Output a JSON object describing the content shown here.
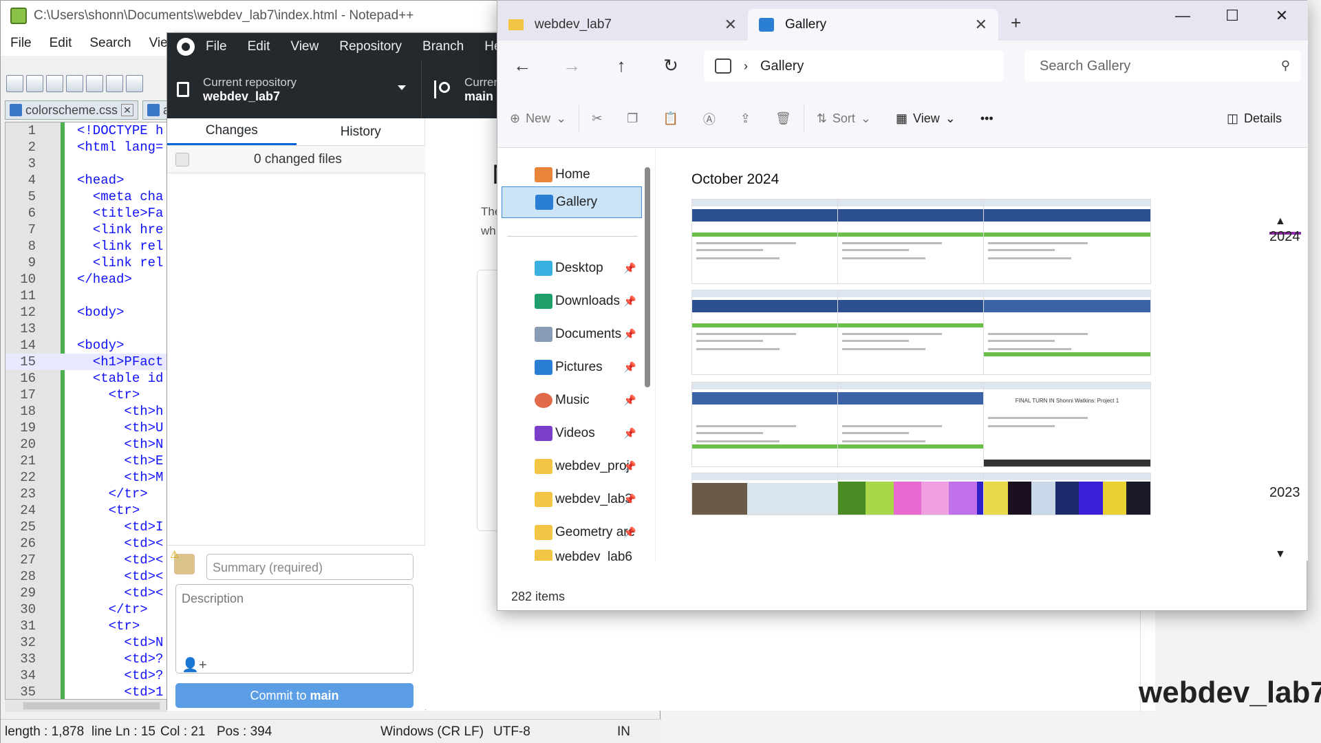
{
  "notepad": {
    "title": "C:\\Users\\shonn\\Documents\\webdev_lab7\\index.html - Notepad++",
    "menu": [
      "File",
      "Edit",
      "Search",
      "View"
    ],
    "tabs": [
      "colorscheme.css",
      "a"
    ],
    "lines": [
      {
        "n": "1",
        "code": "<!DOCTYPE h"
      },
      {
        "n": "2",
        "code": "<html lang="
      },
      {
        "n": "3",
        "code": ""
      },
      {
        "n": "4",
        "code": "<head>"
      },
      {
        "n": "5",
        "code": "  <meta cha"
      },
      {
        "n": "6",
        "code": "  <title>Fa"
      },
      {
        "n": "7",
        "code": "  <link hre"
      },
      {
        "n": "8",
        "code": "  <link rel"
      },
      {
        "n": "9",
        "code": "  <link rel"
      },
      {
        "n": "10",
        "code": "</head>"
      },
      {
        "n": "11",
        "code": ""
      },
      {
        "n": "12",
        "code": "<body>"
      },
      {
        "n": "13",
        "code": ""
      },
      {
        "n": "14",
        "code": "<body>"
      },
      {
        "n": "15",
        "code": "  <h1>PFact"
      },
      {
        "n": "16",
        "code": "  <table id"
      },
      {
        "n": "17",
        "code": "    <tr>"
      },
      {
        "n": "18",
        "code": "      <th>h"
      },
      {
        "n": "19",
        "code": "      <th>U"
      },
      {
        "n": "20",
        "code": "      <th>N"
      },
      {
        "n": "21",
        "code": "      <th>E"
      },
      {
        "n": "22",
        "code": "      <th>M"
      },
      {
        "n": "23",
        "code": "    </tr>"
      },
      {
        "n": "24",
        "code": "    <tr>"
      },
      {
        "n": "25",
        "code": "      <td>I"
      },
      {
        "n": "26",
        "code": "      <td><"
      },
      {
        "n": "27",
        "code": "      <td><"
      },
      {
        "n": "28",
        "code": "      <td><"
      },
      {
        "n": "29",
        "code": "      <td><"
      },
      {
        "n": "30",
        "code": "    </tr>"
      },
      {
        "n": "31",
        "code": "    <tr>"
      },
      {
        "n": "32",
        "code": "      <td>N"
      },
      {
        "n": "33",
        "code": "      <td>?"
      },
      {
        "n": "34",
        "code": "      <td>?"
      },
      {
        "n": "35",
        "code": "      <td>1"
      }
    ],
    "status": {
      "length": "length : 1,878",
      "line": "line Ln : 15",
      "col": "Col : 21",
      "pos": "Pos : 394",
      "eol": "Windows (CR LF)",
      "enc": "UTF-8",
      "ins": "IN"
    }
  },
  "github": {
    "menu": [
      "File",
      "Edit",
      "View",
      "Repository",
      "Branch",
      "Hel"
    ],
    "repo_label": "Current repository",
    "repo_name": "webdev_lab7",
    "branch_label": "Curren",
    "branch_name": "main",
    "tab_changes": "Changes",
    "tab_history": "History",
    "changed_files": "0 changed files",
    "summary_placeholder": "Summary (required)",
    "description_placeholder": "Description",
    "commit_prefix": "Commit to",
    "commit_branch": "main",
    "peek_heading": "N",
    "peek_line1": "The",
    "peek_line2": "wh",
    "peek_title": "webdev_lab7"
  },
  "explorer": {
    "tabs": [
      {
        "label": "webdev_lab7"
      },
      {
        "label": "Gallery"
      }
    ],
    "address": "Gallery",
    "search_placeholder": "Search Gallery",
    "commands": {
      "new": "New",
      "sort": "Sort",
      "view": "View",
      "details": "Details"
    },
    "nav": {
      "home": "Home",
      "gallery": "Gallery",
      "desktop": "Desktop",
      "downloads": "Downloads",
      "documents": "Documents",
      "pictures": "Pictures",
      "music": "Music",
      "videos": "Videos",
      "f1": "webdev_proj",
      "f2": "webdev_lab3",
      "f3": "Geometry are",
      "f4": "webdev_lab6"
    },
    "month": "October 2024",
    "thumb_final_text": "FINAL TURN IN Shonni Watkins: Project 1",
    "years": [
      "2024",
      "2023"
    ],
    "item_count": "282 items",
    "colors": {
      "accent": "#0366d6",
      "selection": "#cce4f7",
      "timeline": "#8e2aa8"
    }
  }
}
